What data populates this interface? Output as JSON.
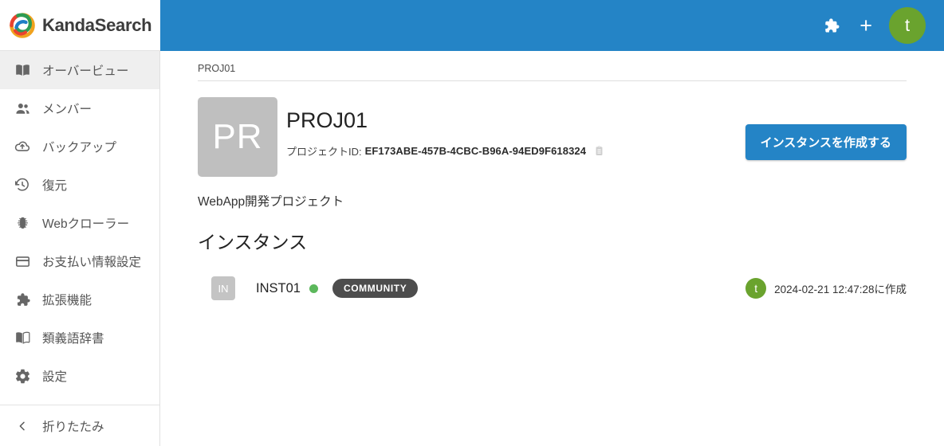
{
  "brand": {
    "name": "KandaSearch",
    "logo_icon": "kandasearch-swirl-logo"
  },
  "topbar": {
    "color": "#2484c6",
    "extensions_icon": "puzzle-piece-icon",
    "add_icon": "plus-icon",
    "add_label": "+",
    "avatar_initial": "t",
    "avatar_color": "#6aa32e"
  },
  "sidebar": {
    "items": [
      {
        "label": "オーバービュー",
        "icon": "book-open-icon",
        "active": true
      },
      {
        "label": "メンバー",
        "icon": "people-icon",
        "active": false
      },
      {
        "label": "バックアップ",
        "icon": "cloud-upload-icon",
        "active": false
      },
      {
        "label": "復元",
        "icon": "history-restore-icon",
        "active": false
      },
      {
        "label": "Webクローラー",
        "icon": "bug-icon",
        "active": false
      },
      {
        "label": "お支払い情報設定",
        "icon": "credit-card-icon",
        "active": false
      },
      {
        "label": "拡張機能",
        "icon": "puzzle-piece-icon",
        "active": false
      },
      {
        "label": "類義語辞書",
        "icon": "book-open-icon",
        "active": false
      },
      {
        "label": "設定",
        "icon": "gear-icon",
        "active": false
      }
    ],
    "collapse": {
      "label": "折りたたみ",
      "icon": "chevron-left-icon"
    }
  },
  "main": {
    "breadcrumb": "PROJ01",
    "project": {
      "tile_initials": "PR",
      "title": "PROJ01",
      "id_label": "プロジェクトID:",
      "id_value": "EF173ABE-457B-4CBC-B96A-94ED9F618324",
      "copy_icon": "clipboard-copy-icon",
      "description": "WebApp開発プロジェクト"
    },
    "create_instance_button": "インスタンスを作成する",
    "instances_heading": "インスタンス",
    "instances": [
      {
        "tile_initials": "IN",
        "name": "INST01",
        "status": "running",
        "status_color": "#5cb85c",
        "plan_badge": "COMMUNITY",
        "owner_initial": "t",
        "created_text": "2024-02-21 12:47:28に作成"
      }
    ]
  }
}
